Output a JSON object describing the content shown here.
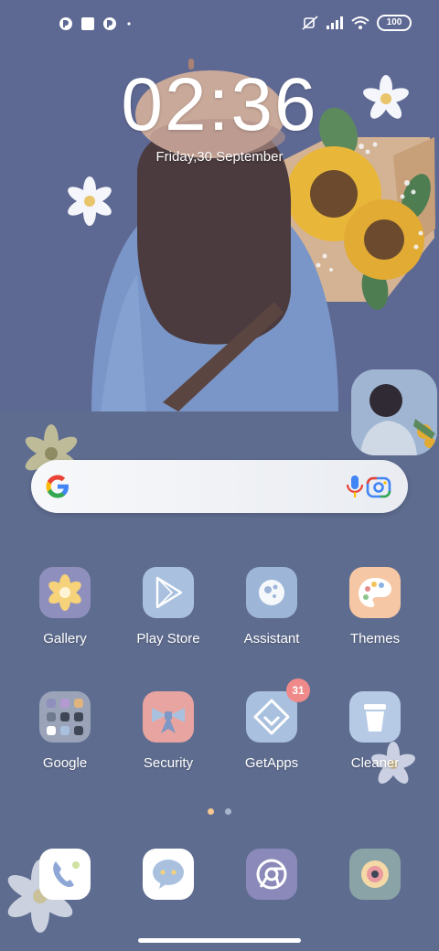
{
  "status": {
    "battery": "100",
    "notification_icons": [
      "app-notification-icon",
      "square-notification-icon",
      "app-notification-icon",
      "dot"
    ],
    "system_icons": [
      "ringer-muted-icon",
      "signal-icon",
      "wifi-icon",
      "battery-icon"
    ]
  },
  "lockclock": {
    "time": "02:36",
    "date": "Friday,30 September"
  },
  "search": {
    "logo": "google-logo",
    "mic_icon": "microphone-icon",
    "lens_icon": "camera-lens-icon"
  },
  "apps": {
    "row1": [
      {
        "label": "Gallery",
        "icon": "gallery-flower-icon",
        "color": "#8e8fbd"
      },
      {
        "label": "Play Store",
        "icon": "play-store-icon",
        "color": "#a9c1df"
      },
      {
        "label": "Assistant",
        "icon": "assistant-icon",
        "color": "#9db6d8"
      },
      {
        "label": "Themes",
        "icon": "themes-palette-icon",
        "color": "#f6c7a4"
      }
    ],
    "row2": [
      {
        "label": "Google",
        "icon": "folder-icon",
        "color": "#9aa3b8"
      },
      {
        "label": "Security",
        "icon": "security-bow-icon",
        "color": "#e8a4a0"
      },
      {
        "label": "GetApps",
        "icon": "getapps-icon",
        "color": "#a9c1df",
        "badge": "31"
      },
      {
        "label": "Cleaner",
        "icon": "cleaner-icon",
        "color": "#b6cae6"
      }
    ]
  },
  "dock": [
    {
      "icon": "phone-icon",
      "color": "#ffffff"
    },
    {
      "icon": "messages-icon",
      "color": "#ffffff"
    },
    {
      "icon": "chrome-browser-icon",
      "color": "#8a89b9"
    },
    {
      "icon": "camera-icon",
      "color": "#8aa3a7"
    }
  ],
  "pager": {
    "active_dot": "#f4c890",
    "inactive_dot": "#a9b5cd"
  },
  "colors": {
    "background": "#5e6c8f",
    "wallpaper_sky": "#5f6993"
  }
}
